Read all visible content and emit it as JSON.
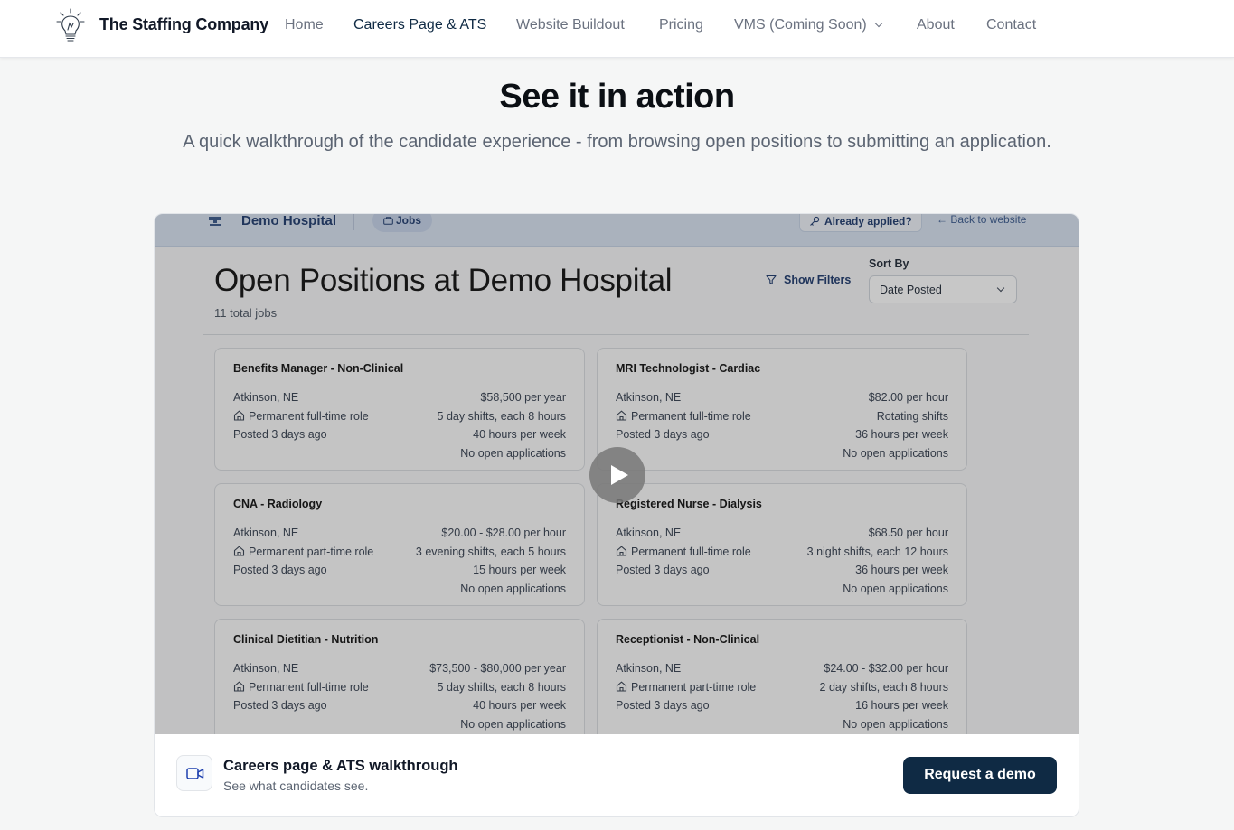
{
  "nav": {
    "brand": "The Staffing Company",
    "brand_icon": "lightbulb-icon",
    "items": [
      {
        "label": "Home"
      },
      {
        "label": "Careers Page & ATS",
        "active": true
      },
      {
        "label": "Website Buildout"
      },
      {
        "label": "Pricing"
      },
      {
        "label": "VMS (Coming Soon)",
        "dropdown": true
      },
      {
        "label": "About"
      },
      {
        "label": "Contact"
      }
    ]
  },
  "hero": {
    "title": "See it in action",
    "subtitle": "A quick walkthrough of the candidate experience - from browsing open positions to submitting an application."
  },
  "video": {
    "header": {
      "org": "Demo Hospital",
      "jobs_tab": "Jobs",
      "already_applied": "Already applied?",
      "back": "Back to website"
    },
    "title": "Open Positions at Demo Hospital",
    "count": "11 total jobs",
    "show_filters": "Show Filters",
    "sort_label": "Sort By",
    "sort_value": "Date Posted",
    "jobs": [
      {
        "title": "Benefits Manager - Non-Clinical",
        "location": "Atkinson, NE",
        "role": "Permanent full-time role",
        "posted": "Posted 3 days ago",
        "pay": "$58,500 per year",
        "shifts": "5 day shifts, each 8 hours",
        "hours": "40 hours per week",
        "apps": "No open applications"
      },
      {
        "title": "MRI Technologist - Cardiac",
        "location": "Atkinson, NE",
        "role": "Permanent full-time role",
        "posted": "Posted 3 days ago",
        "pay": "$82.00 per hour",
        "shifts": "Rotating shifts",
        "hours": "36 hours per week",
        "apps": "No open applications"
      },
      {
        "title": "CNA - Radiology",
        "location": "Atkinson, NE",
        "role": "Permanent part-time role",
        "posted": "Posted 3 days ago",
        "pay": "$20.00 - $28.00 per hour",
        "shifts": "3 evening shifts, each 5 hours",
        "hours": "15 hours per week",
        "apps": "No open applications"
      },
      {
        "title": "Registered Nurse - Dialysis",
        "location": "Atkinson, NE",
        "role": "Permanent full-time role",
        "posted": "Posted 3 days ago",
        "pay": "$68.50 per hour",
        "shifts": "3 night shifts, each 12 hours",
        "hours": "36 hours per week",
        "apps": "No open applications"
      },
      {
        "title": "Clinical Dietitian - Nutrition",
        "location": "Atkinson, NE",
        "role": "Permanent full-time role",
        "posted": "Posted 3 days ago",
        "pay": "$73,500 - $80,000 per year",
        "shifts": "5 day shifts, each 8 hours",
        "hours": "40 hours per week",
        "apps": "No open applications"
      },
      {
        "title": "Receptionist - Non-Clinical",
        "location": "Atkinson, NE",
        "role": "Permanent part-time role",
        "posted": "Posted 3 days ago",
        "pay": "$24.00 - $32.00 per hour",
        "shifts": "2 day shifts, each 8 hours",
        "hours": "16 hours per week",
        "apps": "No open applications"
      }
    ]
  },
  "footer": {
    "title": "Careers page & ATS walkthrough",
    "subtitle": "See what candidates see.",
    "cta": "Request a demo",
    "icon": "video-camera-icon"
  },
  "colors": {
    "primary": "#0f2a44",
    "page_bg": "#f5f6f6"
  }
}
